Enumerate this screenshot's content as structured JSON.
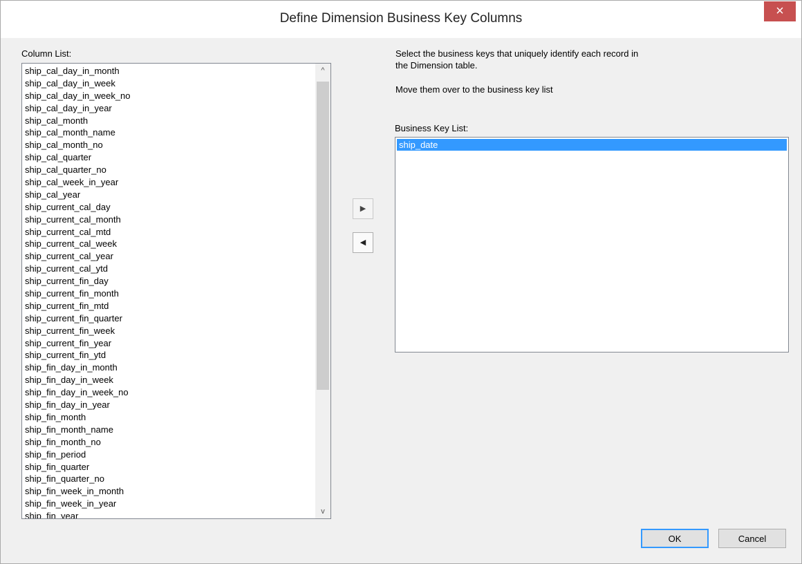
{
  "dialog": {
    "title": "Define Dimension Business Key Columns",
    "close_glyph": "×"
  },
  "column_list": {
    "label": "Column List:",
    "items": [
      "ship_cal_day_in_month",
      "ship_cal_day_in_week",
      "ship_cal_day_in_week_no",
      "ship_cal_day_in_year",
      "ship_cal_month",
      "ship_cal_month_name",
      "ship_cal_month_no",
      "ship_cal_quarter",
      "ship_cal_quarter_no",
      "ship_cal_week_in_year",
      "ship_cal_year",
      "ship_current_cal_day",
      "ship_current_cal_month",
      "ship_current_cal_mtd",
      "ship_current_cal_week",
      "ship_current_cal_year",
      "ship_current_cal_ytd",
      "ship_current_fin_day",
      "ship_current_fin_month",
      "ship_current_fin_mtd",
      "ship_current_fin_quarter",
      "ship_current_fin_week",
      "ship_current_fin_year",
      "ship_current_fin_ytd",
      "ship_fin_day_in_month",
      "ship_fin_day_in_week",
      "ship_fin_day_in_week_no",
      "ship_fin_day_in_year",
      "ship_fin_month",
      "ship_fin_month_name",
      "ship_fin_month_no",
      "ship_fin_period",
      "ship_fin_quarter",
      "ship_fin_quarter_no",
      "ship_fin_week_in_month",
      "ship_fin_week_in_year",
      "ship_fin_year"
    ]
  },
  "instructions": {
    "line1": "Select the business keys that uniquely identify each record in",
    "line2": "the Dimension table.",
    "line3": "Move them over to the business key list"
  },
  "business_key_list": {
    "label": "Business Key List:",
    "items": [
      "ship_date"
    ],
    "selected": "ship_date"
  },
  "buttons": {
    "move_right_glyph": "▶",
    "move_left_glyph": "◀",
    "ok_label": "OK",
    "cancel_label": "Cancel"
  },
  "scroll": {
    "up_glyph": "^",
    "down_glyph": "v"
  },
  "colors": {
    "selection": "#3399ff",
    "close_button": "#c75050"
  }
}
